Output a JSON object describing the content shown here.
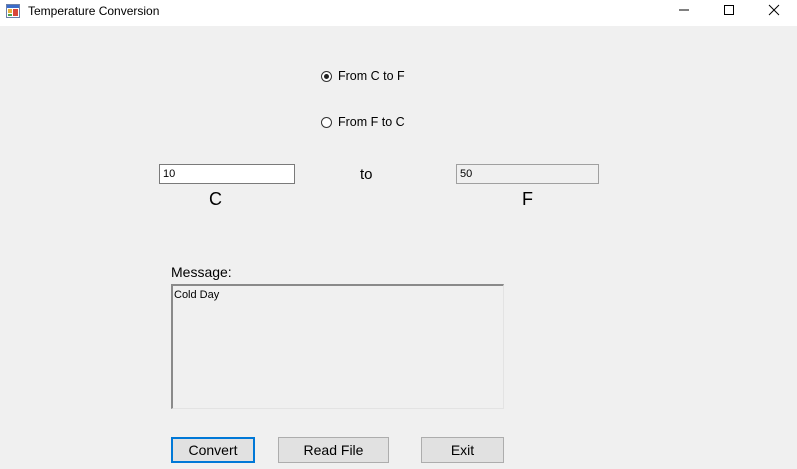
{
  "window": {
    "title": "Temperature Conversion"
  },
  "radios": {
    "c_to_f": {
      "label": "From C to F",
      "checked": true
    },
    "f_to_c": {
      "label": "From F to C",
      "checked": false
    }
  },
  "conversion": {
    "input_value": "10",
    "output_value": "50",
    "input_unit": "C",
    "output_unit": "F",
    "connector": "to"
  },
  "message": {
    "label": "Message:",
    "text": "Cold Day"
  },
  "buttons": {
    "convert": "Convert",
    "read_file": "Read File",
    "exit": "Exit"
  }
}
